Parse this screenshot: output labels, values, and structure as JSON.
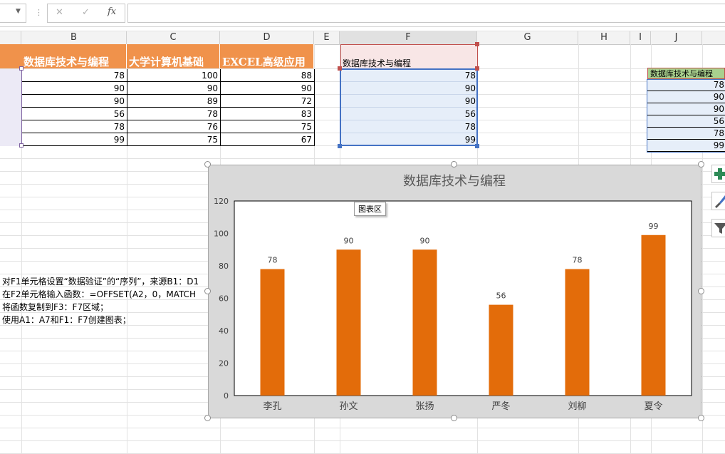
{
  "formula_bar": {
    "cancel_icon": "✕",
    "enter_icon": "✓",
    "fx_label": "fx",
    "formula": ""
  },
  "columns": [
    "B",
    "C",
    "D",
    "E",
    "F",
    "G",
    "H",
    "I",
    "J"
  ],
  "table": {
    "headers": [
      "数据库技术与编程",
      "大学计算机基础",
      "EXCEL高级应用"
    ],
    "rows": [
      [
        "78",
        "100",
        "88"
      ],
      [
        "90",
        "90",
        "90"
      ],
      [
        "90",
        "89",
        "72"
      ],
      [
        "56",
        "78",
        "83"
      ],
      [
        "78",
        "76",
        "75"
      ],
      [
        "99",
        "75",
        "67"
      ]
    ]
  },
  "f_column": {
    "header": "数据库技术与编程",
    "values": [
      "78",
      "90",
      "90",
      "56",
      "78",
      "99"
    ]
  },
  "j_column": {
    "header": "数据库技术与编程",
    "values": [
      "78",
      "90",
      "90",
      "56",
      "78",
      "99"
    ]
  },
  "notes": [
    "对F1单元格设置“数据验证”的“序列”，来源B1：D1",
    "在F2单元格输入函数：=OFFSET(A2，0，MATCH",
    "将函数复制到F3：F7区域；",
    "使用A1：A7和F1：F7创建图表；"
  ],
  "chart_tooltip": "图表区",
  "side_buttons": [
    "plus-icon",
    "brush-icon",
    "filter-icon"
  ],
  "colors": {
    "header_orange": "#f0924b",
    "bar_orange": "#e36c0a",
    "chart_area": "#d9d9d9",
    "selection_blue": "#4472c4"
  },
  "chart_data": {
    "type": "bar",
    "title": "数据库技术与编程",
    "categories": [
      "李孔",
      "孙文",
      "张扬",
      "严冬",
      "刘柳",
      "夏令"
    ],
    "values": [
      78,
      90,
      90,
      56,
      78,
      99
    ],
    "ylim": [
      0,
      120
    ],
    "yticks": [
      0,
      20,
      40,
      60,
      80,
      100,
      120
    ],
    "grid": false,
    "data_labels": true
  }
}
